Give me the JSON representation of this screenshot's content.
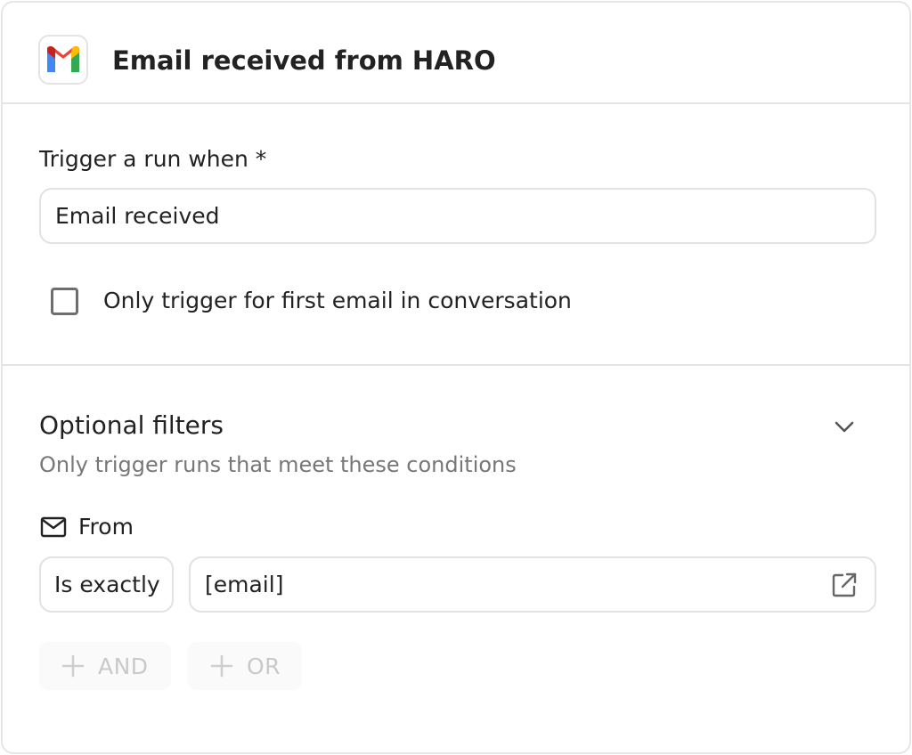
{
  "header": {
    "app_icon": "gmail-icon",
    "title": "Email received from HARO"
  },
  "trigger": {
    "label": "Trigger a run when *",
    "selected_value": "Email received",
    "checkbox_label": "Only trigger for first email in conversation",
    "checkbox_checked": false
  },
  "filters": {
    "title": "Optional filters",
    "subtitle": "Only trigger runs that meet these conditions",
    "condition": {
      "field_icon": "mail-icon",
      "field_label": "From",
      "operator": "Is exactly",
      "value": "[email]"
    },
    "and_button": "AND",
    "or_button": "OR"
  },
  "colors": {
    "border": "#e2e2e2",
    "text": "#222222",
    "muted_text": "#777777",
    "disabled_text": "#c9c9c9",
    "gmail_red": "#ea4335",
    "gmail_blue": "#4285f4",
    "gmail_green": "#34a853",
    "gmail_yellow": "#fbbc04"
  }
}
